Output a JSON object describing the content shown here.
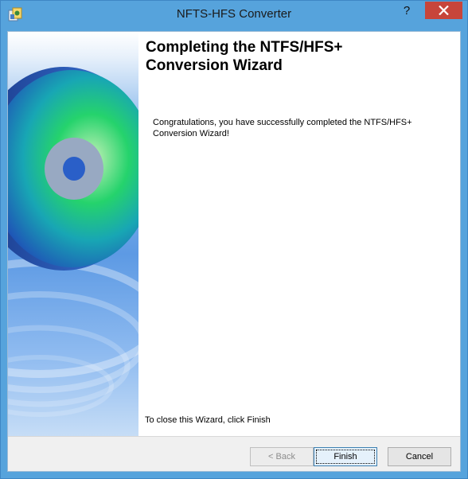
{
  "window": {
    "title": "NFTS-HFS Converter",
    "help_label": "?",
    "icon": "app-icon",
    "close_icon": "close-icon"
  },
  "banner": {
    "image": "cd-disc-illustration"
  },
  "wizard": {
    "heading_line1": "Completing the NTFS/HFS+",
    "heading_line2": "Conversion Wizard",
    "message": "Congratulations, you have successfully completed the NTFS/HFS+ Conversion Wizard!",
    "close_hint": "To close this Wizard, click Finish"
  },
  "buttons": {
    "back_label": "< Back",
    "finish_label": "Finish",
    "cancel_label": "Cancel"
  },
  "colors": {
    "title_bar": "#56a3dc",
    "close_button": "#c7453b",
    "banner_blue": "#2a6fc9",
    "disc_green": "#1fd06a"
  }
}
